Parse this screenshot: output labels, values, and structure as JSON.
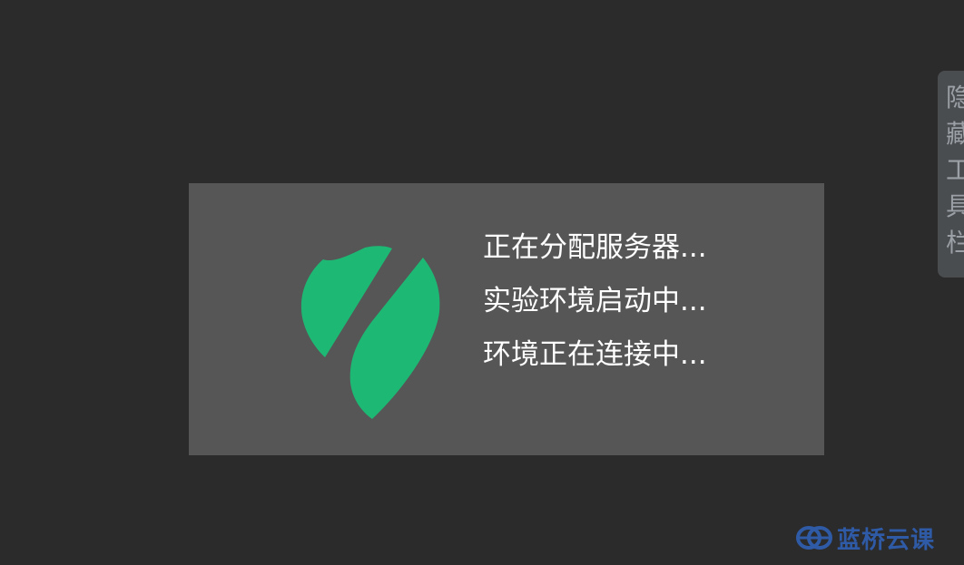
{
  "loading": {
    "status_lines": [
      "正在分配服务器...",
      "实验环境启动中...",
      "环境正在连接中..."
    ]
  },
  "toolbar": {
    "hide_label": "隐藏工具栏"
  },
  "watermark": {
    "brand_text": "蓝桥云课"
  },
  "colors": {
    "background": "#2b2b2b",
    "panel": "#565656",
    "logo_green": "#1db974",
    "toolbar_tab": "#4a4d50",
    "toolbar_text": "#9aa0a6",
    "watermark_blue": "#2f5aa6"
  },
  "icons": {
    "logo": "shield-split-logo-icon",
    "watermark": "lanqiao-logo-icon"
  }
}
